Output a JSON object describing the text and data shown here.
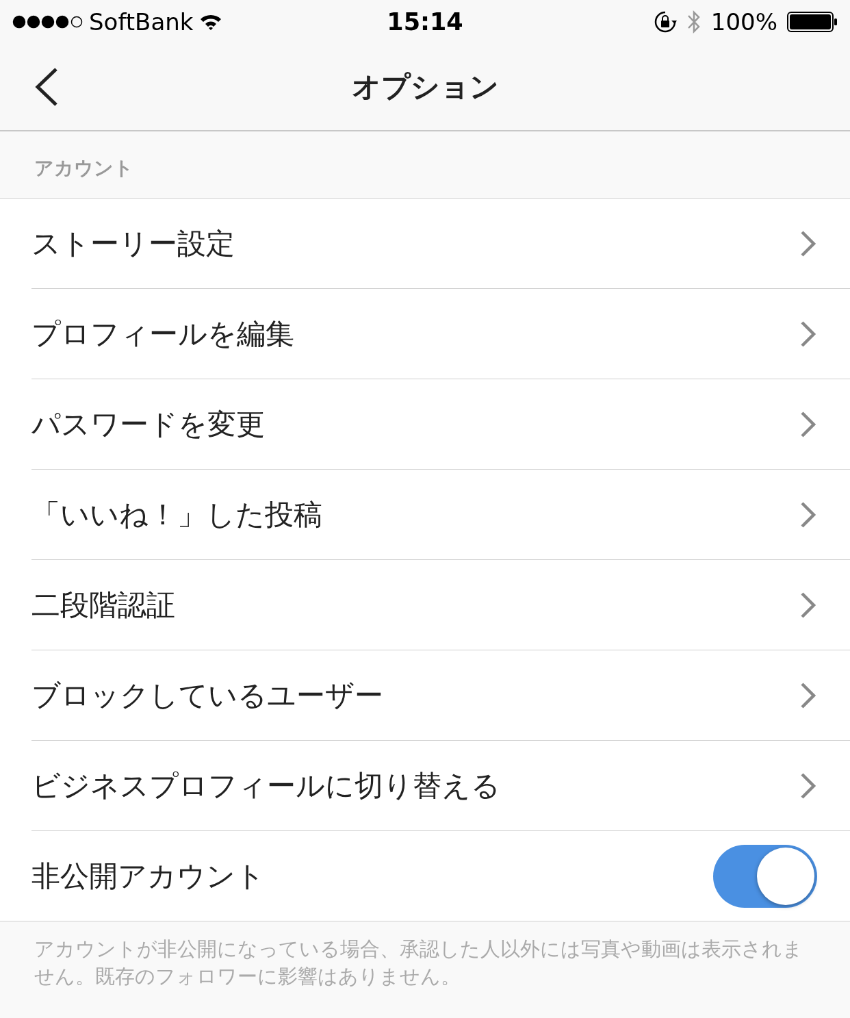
{
  "status_bar": {
    "carrier": "SoftBank",
    "time": "15:14",
    "battery": "100%"
  },
  "nav": {
    "title": "オプション"
  },
  "section": {
    "header": "アカウント",
    "items": [
      {
        "label": "ストーリー設定",
        "kind": "link"
      },
      {
        "label": "プロフィールを編集",
        "kind": "link"
      },
      {
        "label": "パスワードを変更",
        "kind": "link"
      },
      {
        "label": "「いいね！」した投稿",
        "kind": "link"
      },
      {
        "label": "二段階認証",
        "kind": "link"
      },
      {
        "label": "ブロックしているユーザー",
        "kind": "link"
      },
      {
        "label": "ビジネスプロフィールに切り替える",
        "kind": "link"
      },
      {
        "label": "非公開アカウント",
        "kind": "toggle",
        "on": true
      }
    ],
    "footer": "アカウントが非公開になっている場合、承認した人以外には写真や動画は表示されません。既存のフォロワーに影響はありません。"
  }
}
